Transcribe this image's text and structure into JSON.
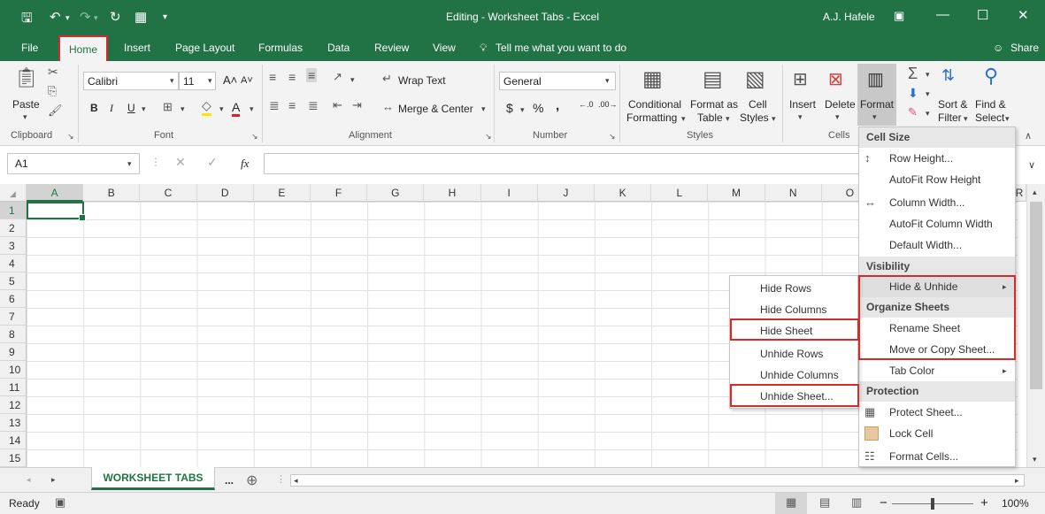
{
  "window": {
    "title": "Editing - Worksheet Tabs  -  Excel",
    "user": "A.J. Hafele"
  },
  "tabs": [
    "File",
    "Home",
    "Insert",
    "Page Layout",
    "Formulas",
    "Data",
    "Review",
    "View"
  ],
  "tell_me": "Tell me what you want to do",
  "share": "Share",
  "ribbon": {
    "paste": "Paste",
    "font_name": "Calibri",
    "font_size": "11",
    "bold": "B",
    "italic": "I",
    "underline": "U",
    "wrap_text": "Wrap Text",
    "merge_center": "Merge & Center",
    "number_format": "General",
    "currency": "$",
    "percent": "%",
    "comma": ",",
    "conditional_formatting_1": "Conditional",
    "conditional_formatting_2": "Formatting",
    "format_as_table_1": "Format as",
    "format_as_table_2": "Table",
    "cell_styles_1": "Cell",
    "cell_styles_2": "Styles",
    "insert": "Insert",
    "delete": "Delete",
    "format": "Format",
    "sort_filter_1": "Sort &",
    "sort_filter_2": "Filter",
    "find_select_1": "Find &",
    "find_select_2": "Select",
    "groups": {
      "clipboard": "Clipboard",
      "font": "Font",
      "alignment": "Alignment",
      "number": "Number",
      "styles": "Styles",
      "cells": "Cells"
    }
  },
  "formula_bar": {
    "name_box": "A1",
    "fx": "fx",
    "value": ""
  },
  "grid": {
    "columns": [
      "A",
      "B",
      "C",
      "D",
      "E",
      "F",
      "G",
      "H",
      "I",
      "J",
      "K",
      "L",
      "M",
      "N",
      "O"
    ],
    "rows": [
      "1",
      "2",
      "3",
      "4",
      "5",
      "6",
      "7",
      "8",
      "9",
      "10",
      "11",
      "12",
      "13",
      "14",
      "15"
    ],
    "partial_column": "R"
  },
  "sheets": {
    "active": "WORKSHEET TABS",
    "more": "..."
  },
  "status": {
    "ready": "Ready",
    "zoom": "100%",
    "zoom_minus": "−",
    "zoom_plus": "+"
  },
  "format_menu": {
    "cell_size": "Cell Size",
    "row_height": "Row Height...",
    "autofit_row_height": "AutoFit Row Height",
    "column_width": "Column Width...",
    "autofit_column_width": "AutoFit Column Width",
    "default_width": "Default Width...",
    "visibility": "Visibility",
    "hide_unhide": "Hide & Unhide",
    "organize_sheets": "Organize Sheets",
    "rename_sheet": "Rename Sheet",
    "move_copy_sheet": "Move or Copy Sheet...",
    "tab_color": "Tab Color",
    "protection": "Protection",
    "protect_sheet": "Protect Sheet...",
    "lock_cell": "Lock Cell",
    "format_cells": "Format Cells..."
  },
  "hide_menu": {
    "hide_rows": "Hide Rows",
    "hide_columns": "Hide Columns",
    "hide_sheet": "Hide Sheet",
    "unhide_rows": "Unhide Rows",
    "unhide_columns": "Unhide Columns",
    "unhide_sheet": "Unhide Sheet..."
  },
  "colors": {
    "excel_green": "#217346",
    "highlight_red": "#d72a2a"
  }
}
